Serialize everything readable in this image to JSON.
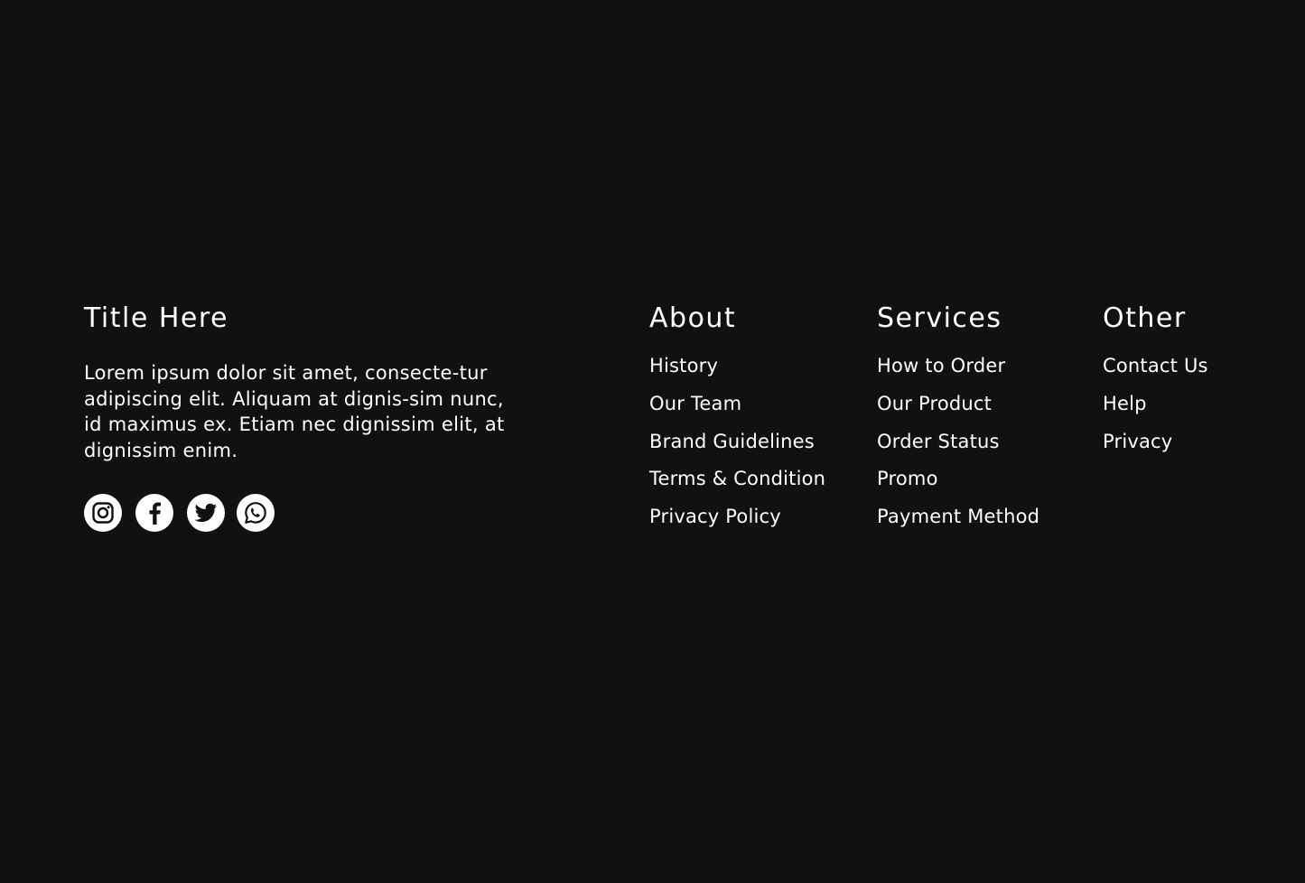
{
  "brand": {
    "title": "Title Here",
    "description": "Lorem ipsum dolor sit amet, consecte-tur adipiscing elit. Aliquam at dignis-sim nunc, id maximus ex. Etiam nec dignissim elit, at dignissim enim."
  },
  "socials": [
    {
      "icon": "instagram-icon"
    },
    {
      "icon": "facebook-icon"
    },
    {
      "icon": "twitter-icon"
    },
    {
      "icon": "whatsapp-icon"
    }
  ],
  "columns": {
    "about": {
      "title": "About",
      "links": [
        "History",
        "Our Team",
        "Brand Guidelines",
        "Terms & Condition",
        "Privacy Policy"
      ]
    },
    "services": {
      "title": "Services",
      "links": [
        "How to Order",
        "Our Product",
        "Order Status",
        "Promo",
        "Payment Method"
      ]
    },
    "other": {
      "title": "Other",
      "links": [
        "Contact Us",
        "Help",
        "Privacy"
      ]
    }
  },
  "colors": {
    "background": "#111111",
    "text": "#ffffff",
    "icon_bg": "#ffffff",
    "icon_fg": "#111111"
  }
}
